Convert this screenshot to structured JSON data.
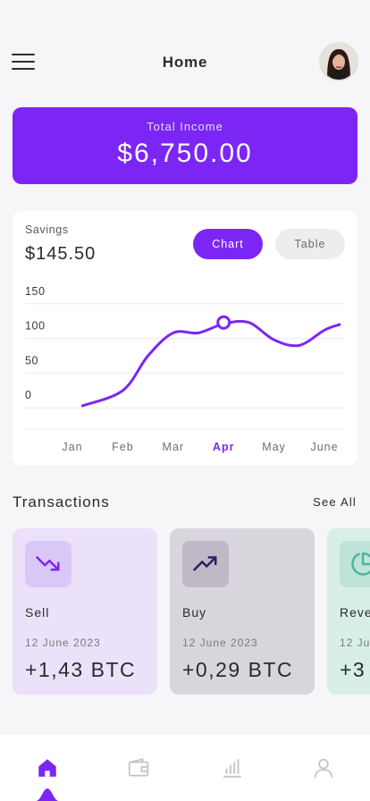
{
  "header": {
    "title": "Home",
    "menu_icon": "hamburger-menu-icon",
    "avatar": "user-avatar"
  },
  "income": {
    "label": "Total Income",
    "value": "$6,750.00",
    "color": "#7b26f5"
  },
  "savings": {
    "label": "Savings",
    "value": "$145.50",
    "toggle": {
      "chart_label": "Chart",
      "table_label": "Table",
      "selected": "Chart"
    }
  },
  "chart_data": {
    "type": "line",
    "categories": [
      "Jan",
      "Feb",
      "Mar",
      "Apr",
      "May",
      "June"
    ],
    "highlighted_category": "Apr",
    "series": [
      {
        "x": [
          0.2,
          1.0,
          1.5,
          2.0,
          2.5,
          3.0,
          3.5,
          4.0,
          4.5,
          5.0,
          5.3
        ],
        "values": [
          3,
          25,
          75,
          108,
          108,
          121,
          123,
          98,
          90,
          112,
          120
        ]
      }
    ],
    "highlight_point": {
      "x": 3.0,
      "y": 123
    },
    "yticks": [
      0,
      50,
      100,
      150
    ],
    "ylim": [
      -10,
      160
    ],
    "grid": true,
    "line_color": "#7b26f5"
  },
  "transactions": {
    "title": "Transactions",
    "see_all": "See All",
    "items": [
      {
        "name": "Sell",
        "date": "12 June 2023",
        "amount": "+1,43 BTC",
        "icon": "trending-down-icon",
        "bg": "#ebe1fb",
        "icon_bg": "#d9c8f7",
        "icon_color": "#7b26f5"
      },
      {
        "name": "Buy",
        "date": "12 June 2023",
        "amount": "+0,29 BTC",
        "icon": "trending-up-icon",
        "bg": "#d9d5dd",
        "icon_bg": "#bfb8c6",
        "icon_color": "#2b2060"
      },
      {
        "name": "Reve",
        "date": "12 Ju",
        "amount": "+3",
        "icon": "pie-chart-icon",
        "bg": "#d8efe9",
        "icon_bg": "#bfe3d9",
        "icon_color": "#4fb3a0"
      }
    ]
  },
  "nav": {
    "items": [
      {
        "icon": "home-icon",
        "active": true
      },
      {
        "icon": "wallet-icon",
        "active": false
      },
      {
        "icon": "bar-chart-icon",
        "active": false
      },
      {
        "icon": "profile-icon",
        "active": false
      }
    ],
    "active_color": "#7b26f5",
    "inactive_color": "#c4c4c4"
  }
}
